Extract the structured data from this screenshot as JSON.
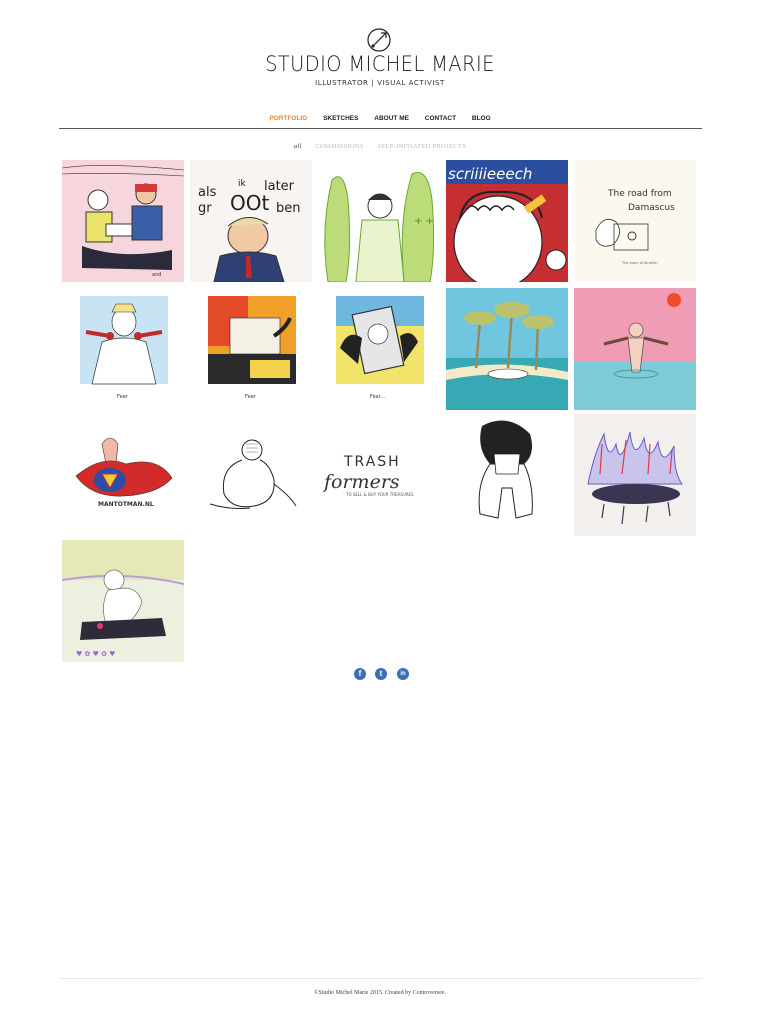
{
  "brand": {
    "title": "STUDIO MICHEL MARIE",
    "subtitle": "ILLUSTRATOR | VISUAL ACTIVIST",
    "logo_icon": "crossed-arrows-compass-icon"
  },
  "nav": {
    "items": [
      "PORTFOLIO",
      "SKETCHES",
      "ABOUT ME",
      "CONTACT",
      "BLOG"
    ],
    "active": "PORTFOLIO",
    "accent": "#e8862a"
  },
  "filters": {
    "items": [
      "all",
      "COMMISSIONS",
      "SELF-INITIATED PROJECTS"
    ],
    "active": "all"
  },
  "portfolio": {
    "tiles": [
      {
        "subject": "illustration-protest-figures"
      },
      {
        "subject": "illustration-als-ik-later-groot-ben",
        "text": "als ik later groot ben"
      },
      {
        "subject": "illustration-green-cactus-figure"
      },
      {
        "subject": "illustration-screech",
        "text": "scriiiieeeech"
      },
      {
        "subject": "illustration-road-from-damascus",
        "text": "The road from Damascus"
      },
      {
        "subject": "illustration-fear-officer",
        "caption": "Fear"
      },
      {
        "subject": "illustration-fear-car",
        "caption": "Fear"
      },
      {
        "subject": "illustration-fear-phone",
        "caption": "Fear..."
      },
      {
        "subject": "illustration-palm-beach"
      },
      {
        "subject": "illustration-sunset-swimmer"
      },
      {
        "subject": "illustration-mantotman-superhero",
        "text": "MANTOTMAN.NL"
      },
      {
        "subject": "illustration-curled-figure-sketch"
      },
      {
        "subject": "illustration-trash-formers",
        "text": "TRASH formers",
        "subtext": "TO SELL & BUY YOUR TREASURES"
      },
      {
        "subject": "illustration-crying-figure"
      },
      {
        "subject": "illustration-purple-flames"
      },
      {
        "subject": "illustration-figure-with-flowers"
      }
    ]
  },
  "social": {
    "icons": [
      "facebook-icon",
      "twitter-icon",
      "linkedin-icon"
    ],
    "glyphs": [
      "f",
      "t",
      "in"
    ],
    "color": "#3b6fb6"
  },
  "footer": {
    "text": "©Studio Michel Marie 2015. Created by Controversee."
  }
}
